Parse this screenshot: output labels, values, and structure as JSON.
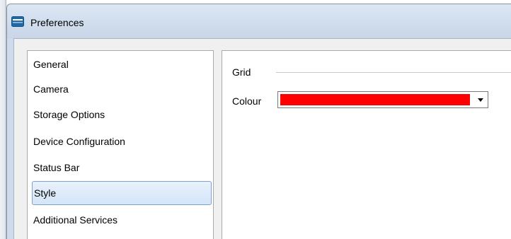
{
  "window": {
    "title": "Preferences",
    "icon": "app-window-icon"
  },
  "sidebar": {
    "items": [
      {
        "label": "General",
        "selected": false
      },
      {
        "label": "Camera",
        "selected": false
      },
      {
        "label": "Storage Options",
        "selected": false
      },
      {
        "label": "Device Configuration",
        "selected": false
      },
      {
        "label": "Status Bar",
        "selected": false
      },
      {
        "label": "Style",
        "selected": true
      },
      {
        "label": "Additional Services",
        "selected": false
      }
    ]
  },
  "style_panel": {
    "group_label": "Grid",
    "colour_label": "Colour",
    "colour_value": "#ff0000"
  },
  "colors": {
    "accent_selection": "#d4e5f8",
    "titlebar": "#cfdbea",
    "icon_blue": "#1f6aa5"
  }
}
